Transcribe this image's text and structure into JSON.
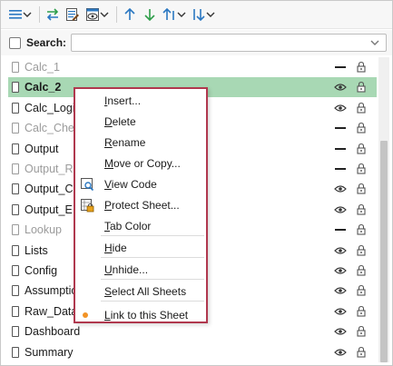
{
  "toolbar": {
    "buttons": [
      {
        "name": "view-options-button",
        "icon": "list-lines-icon"
      },
      {
        "name": "sync-button",
        "icon": "arrows-swap-icon"
      },
      {
        "name": "edit-sheet-button",
        "icon": "sheet-edit-icon"
      },
      {
        "name": "preview-button",
        "icon": "sheet-eye-icon"
      },
      {
        "name": "move-up-button",
        "icon": "arrow-up-icon"
      },
      {
        "name": "move-down-button",
        "icon": "arrow-down-icon"
      },
      {
        "name": "sort-asc-button",
        "icon": "sort-up-icon"
      },
      {
        "name": "sort-desc-button",
        "icon": "sort-down-icon"
      }
    ]
  },
  "search": {
    "label": "Search:",
    "value": "",
    "checked": false
  },
  "sheets": [
    {
      "label": "Calc_1",
      "hidden": true,
      "visibility": "dash",
      "selected": false
    },
    {
      "label": "Calc_2",
      "hidden": false,
      "visibility": "eye",
      "selected": true
    },
    {
      "label": "Calc_Logi",
      "hidden": false,
      "visibility": "eye",
      "selected": false
    },
    {
      "label": "Calc_Chec",
      "hidden": true,
      "visibility": "dash",
      "selected": false
    },
    {
      "label": "Output",
      "hidden": false,
      "visibility": "dash",
      "selected": false
    },
    {
      "label": "Output_R",
      "hidden": true,
      "visibility": "dash",
      "selected": false
    },
    {
      "label": "Output_C",
      "hidden": false,
      "visibility": "eye",
      "selected": false
    },
    {
      "label": "Output_E",
      "hidden": false,
      "visibility": "eye",
      "selected": false
    },
    {
      "label": "Lookup",
      "hidden": true,
      "visibility": "dash",
      "selected": false
    },
    {
      "label": "Lists",
      "hidden": false,
      "visibility": "eye",
      "selected": false
    },
    {
      "label": "Config",
      "hidden": false,
      "visibility": "eye",
      "selected": false
    },
    {
      "label": "Assumptio",
      "hidden": false,
      "visibility": "eye",
      "selected": false
    },
    {
      "label": "Raw_Data",
      "hidden": false,
      "visibility": "eye",
      "selected": false
    },
    {
      "label": "Dashboard",
      "hidden": false,
      "visibility": "eye",
      "selected": false
    },
    {
      "label": "Summary",
      "hidden": false,
      "visibility": "eye",
      "selected": false
    }
  ],
  "context_menu": {
    "items": [
      {
        "label": "Insert...",
        "name": "menu-insert",
        "icon": "",
        "ul": 0
      },
      {
        "label": "Delete",
        "name": "menu-delete",
        "icon": "",
        "ul": 0
      },
      {
        "label": "Rename",
        "name": "menu-rename",
        "icon": "",
        "ul": 0
      },
      {
        "label": "Move or Copy...",
        "name": "menu-move-copy",
        "icon": "",
        "ul": 0
      },
      {
        "label": "View Code",
        "name": "menu-view-code",
        "icon": "view-code-icon",
        "ul": 0
      },
      {
        "label": "Protect Sheet...",
        "name": "menu-protect-sheet",
        "icon": "protect-sheet-icon",
        "ul": 0
      },
      {
        "label": "Tab Color",
        "name": "menu-tab-color",
        "icon": "",
        "ul": 0
      },
      {
        "label": "Hide",
        "name": "menu-hide",
        "icon": "",
        "ul": 0
      },
      {
        "label": "Unhide...",
        "name": "menu-unhide",
        "icon": "",
        "ul": 0
      },
      {
        "label": "Select All Sheets",
        "name": "menu-select-all",
        "icon": "",
        "ul": 0
      },
      {
        "label": "Link to this Sheet",
        "name": "menu-link-sheet",
        "icon": "bullet-dot-icon",
        "ul": 0
      }
    ]
  },
  "colors": {
    "selected_row": "#a8d8b4",
    "menu_border": "#b0384e",
    "accent_blue": "#2b78c2",
    "accent_green": "#2e9e4a",
    "bullet": "#f29326"
  }
}
